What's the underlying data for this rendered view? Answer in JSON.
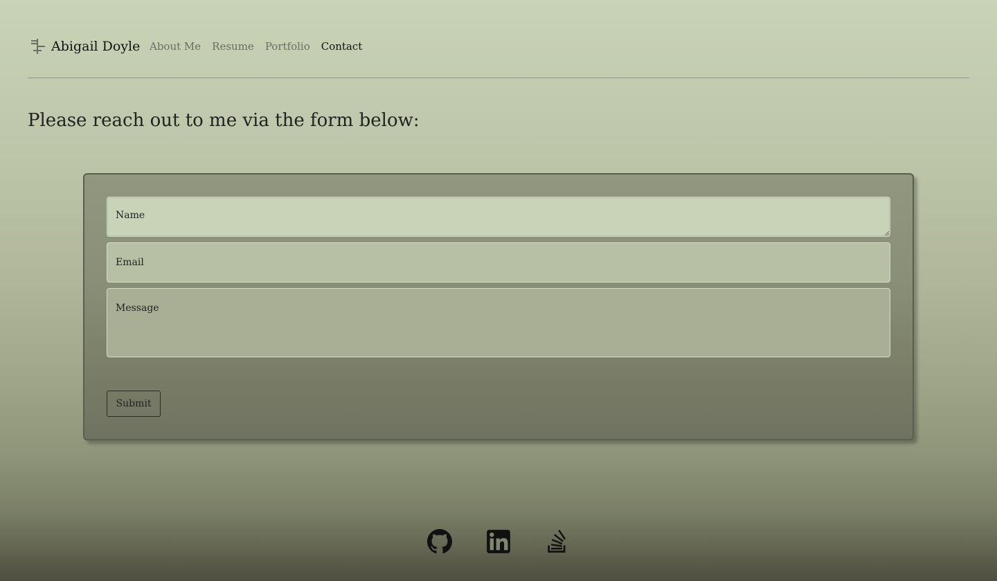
{
  "nav": {
    "brand_name": "Abigail Doyle",
    "brand_icon": "signpost-icon",
    "links": [
      {
        "label": "About Me",
        "active": false
      },
      {
        "label": "Resume",
        "active": false
      },
      {
        "label": "Portfolio",
        "active": false
      },
      {
        "label": "Contact",
        "active": true
      }
    ]
  },
  "main": {
    "heading": "Please reach out to me via the form below:"
  },
  "form": {
    "name_placeholder": "Name",
    "email_placeholder": "Email",
    "message_placeholder": "Message",
    "submit_label": "Submit"
  },
  "footer": {
    "social_icons": [
      "github-icon",
      "linkedin-icon",
      "stackoverflow-icon"
    ]
  },
  "colors": {
    "text": "#222222",
    "nav_link": "#6a6d63",
    "card_border": "#5a5e4f"
  }
}
